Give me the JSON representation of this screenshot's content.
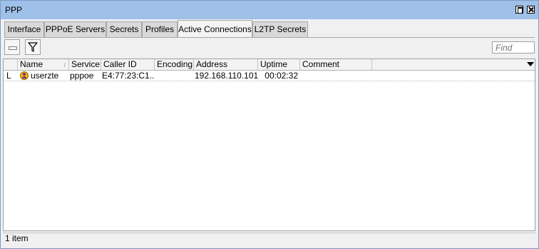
{
  "window": {
    "title": "PPP"
  },
  "tabs": [
    {
      "label": "Interface"
    },
    {
      "label": "PPPoE Servers"
    },
    {
      "label": "Secrets"
    },
    {
      "label": "Profiles"
    },
    {
      "label": "Active Connections"
    },
    {
      "label": "L2TP Secrets"
    }
  ],
  "active_tab": "Active Connections",
  "toolbar": {
    "remove_icon": "minus-icon",
    "filter_icon": "filter-icon"
  },
  "search": {
    "placeholder": "Find"
  },
  "table": {
    "columns": [
      "Name",
      "Service",
      "Caller ID",
      "Encoding",
      "Address",
      "Uptime",
      "Comment"
    ],
    "rows": [
      {
        "flag": "L",
        "name": "userzte",
        "service": "pppoe",
        "caller_id": "E4:77:23:C1...",
        "encoding": "",
        "address": "192.168.110.101",
        "uptime": "00:02:32",
        "comment": ""
      }
    ]
  },
  "status": {
    "count_text": "1 item"
  }
}
